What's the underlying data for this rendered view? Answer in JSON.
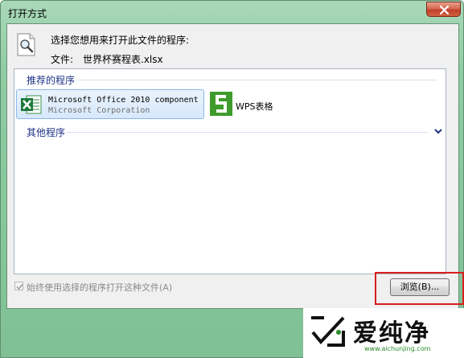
{
  "window": {
    "title": "打开方式",
    "close_icon": "close-icon"
  },
  "header": {
    "prompt": "选择您想用来打开此文件的程序:",
    "file_label": "文件:",
    "file_name": "世界杯赛程表.xlsx"
  },
  "recommended": {
    "label": "推荐的程序",
    "items": [
      {
        "name": "Microsoft Office 2010 component",
        "company": "Microsoft Corporation",
        "icon": "excel-icon",
        "selected": true
      },
      {
        "name": "WPS表格",
        "company": "",
        "icon": "wps-spreadsheet-icon",
        "selected": false
      }
    ]
  },
  "other": {
    "label": "其他程序",
    "expand_icon": "chevron-down-icon"
  },
  "footer": {
    "always_use_label": "始终使用选择的程序打开这种文件(A)",
    "always_use_checked": true,
    "always_use_enabled": false,
    "browse_label": "浏览(B)..."
  },
  "watermark": {
    "text": "爱纯净",
    "url": "www.aichunjing.com"
  },
  "colors": {
    "frame": "#86c79b",
    "group_header": "#1e3287",
    "highlight_outline": "#d81e1e",
    "excel_green": "#1d7a3a",
    "wps_green": "#3f9b2c"
  }
}
